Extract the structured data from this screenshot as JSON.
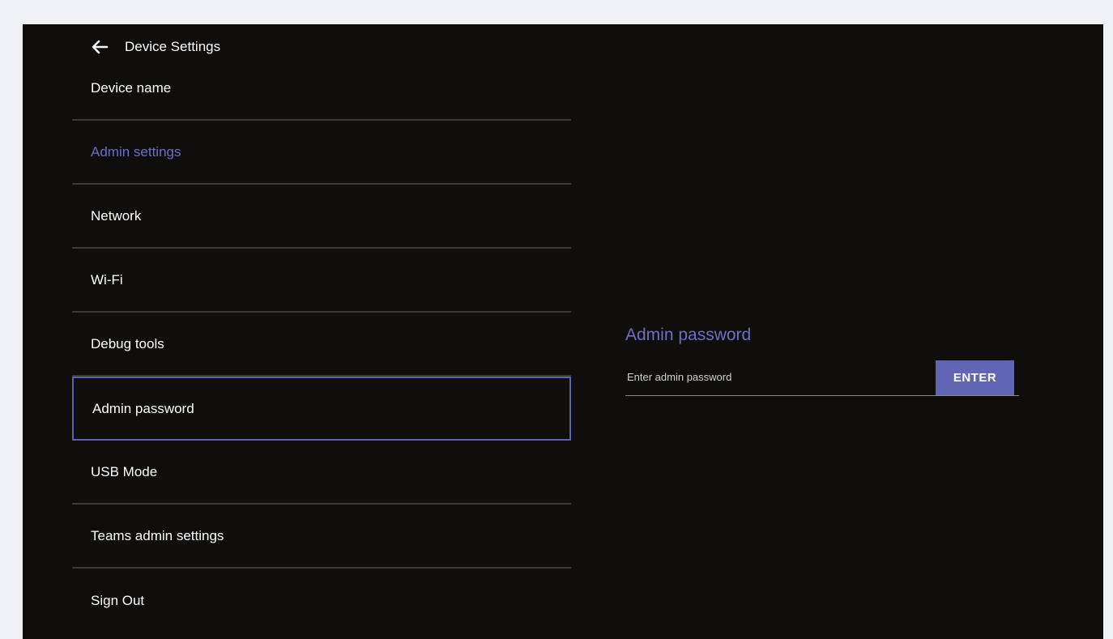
{
  "header": {
    "title": "Device Settings",
    "back_icon": "arrow-left-icon"
  },
  "menu": {
    "items": [
      {
        "label": "Device name"
      },
      {
        "label": "Admin settings",
        "accent": true
      },
      {
        "label": "Network"
      },
      {
        "label": "Wi-Fi"
      },
      {
        "label": "Debug tools"
      },
      {
        "label": "Admin password",
        "selected": true
      },
      {
        "label": "USB Mode"
      },
      {
        "label": "Teams admin settings"
      },
      {
        "label": "Sign Out"
      }
    ]
  },
  "panel": {
    "title": "Admin password",
    "input_value": "",
    "input_placeholder": "Enter admin password",
    "enter_label": "ENTER"
  },
  "colors": {
    "background": "#0f0e0d",
    "accent": "#6c6fc2",
    "button": "#6165b6",
    "divider": "#3a3a3a"
  }
}
